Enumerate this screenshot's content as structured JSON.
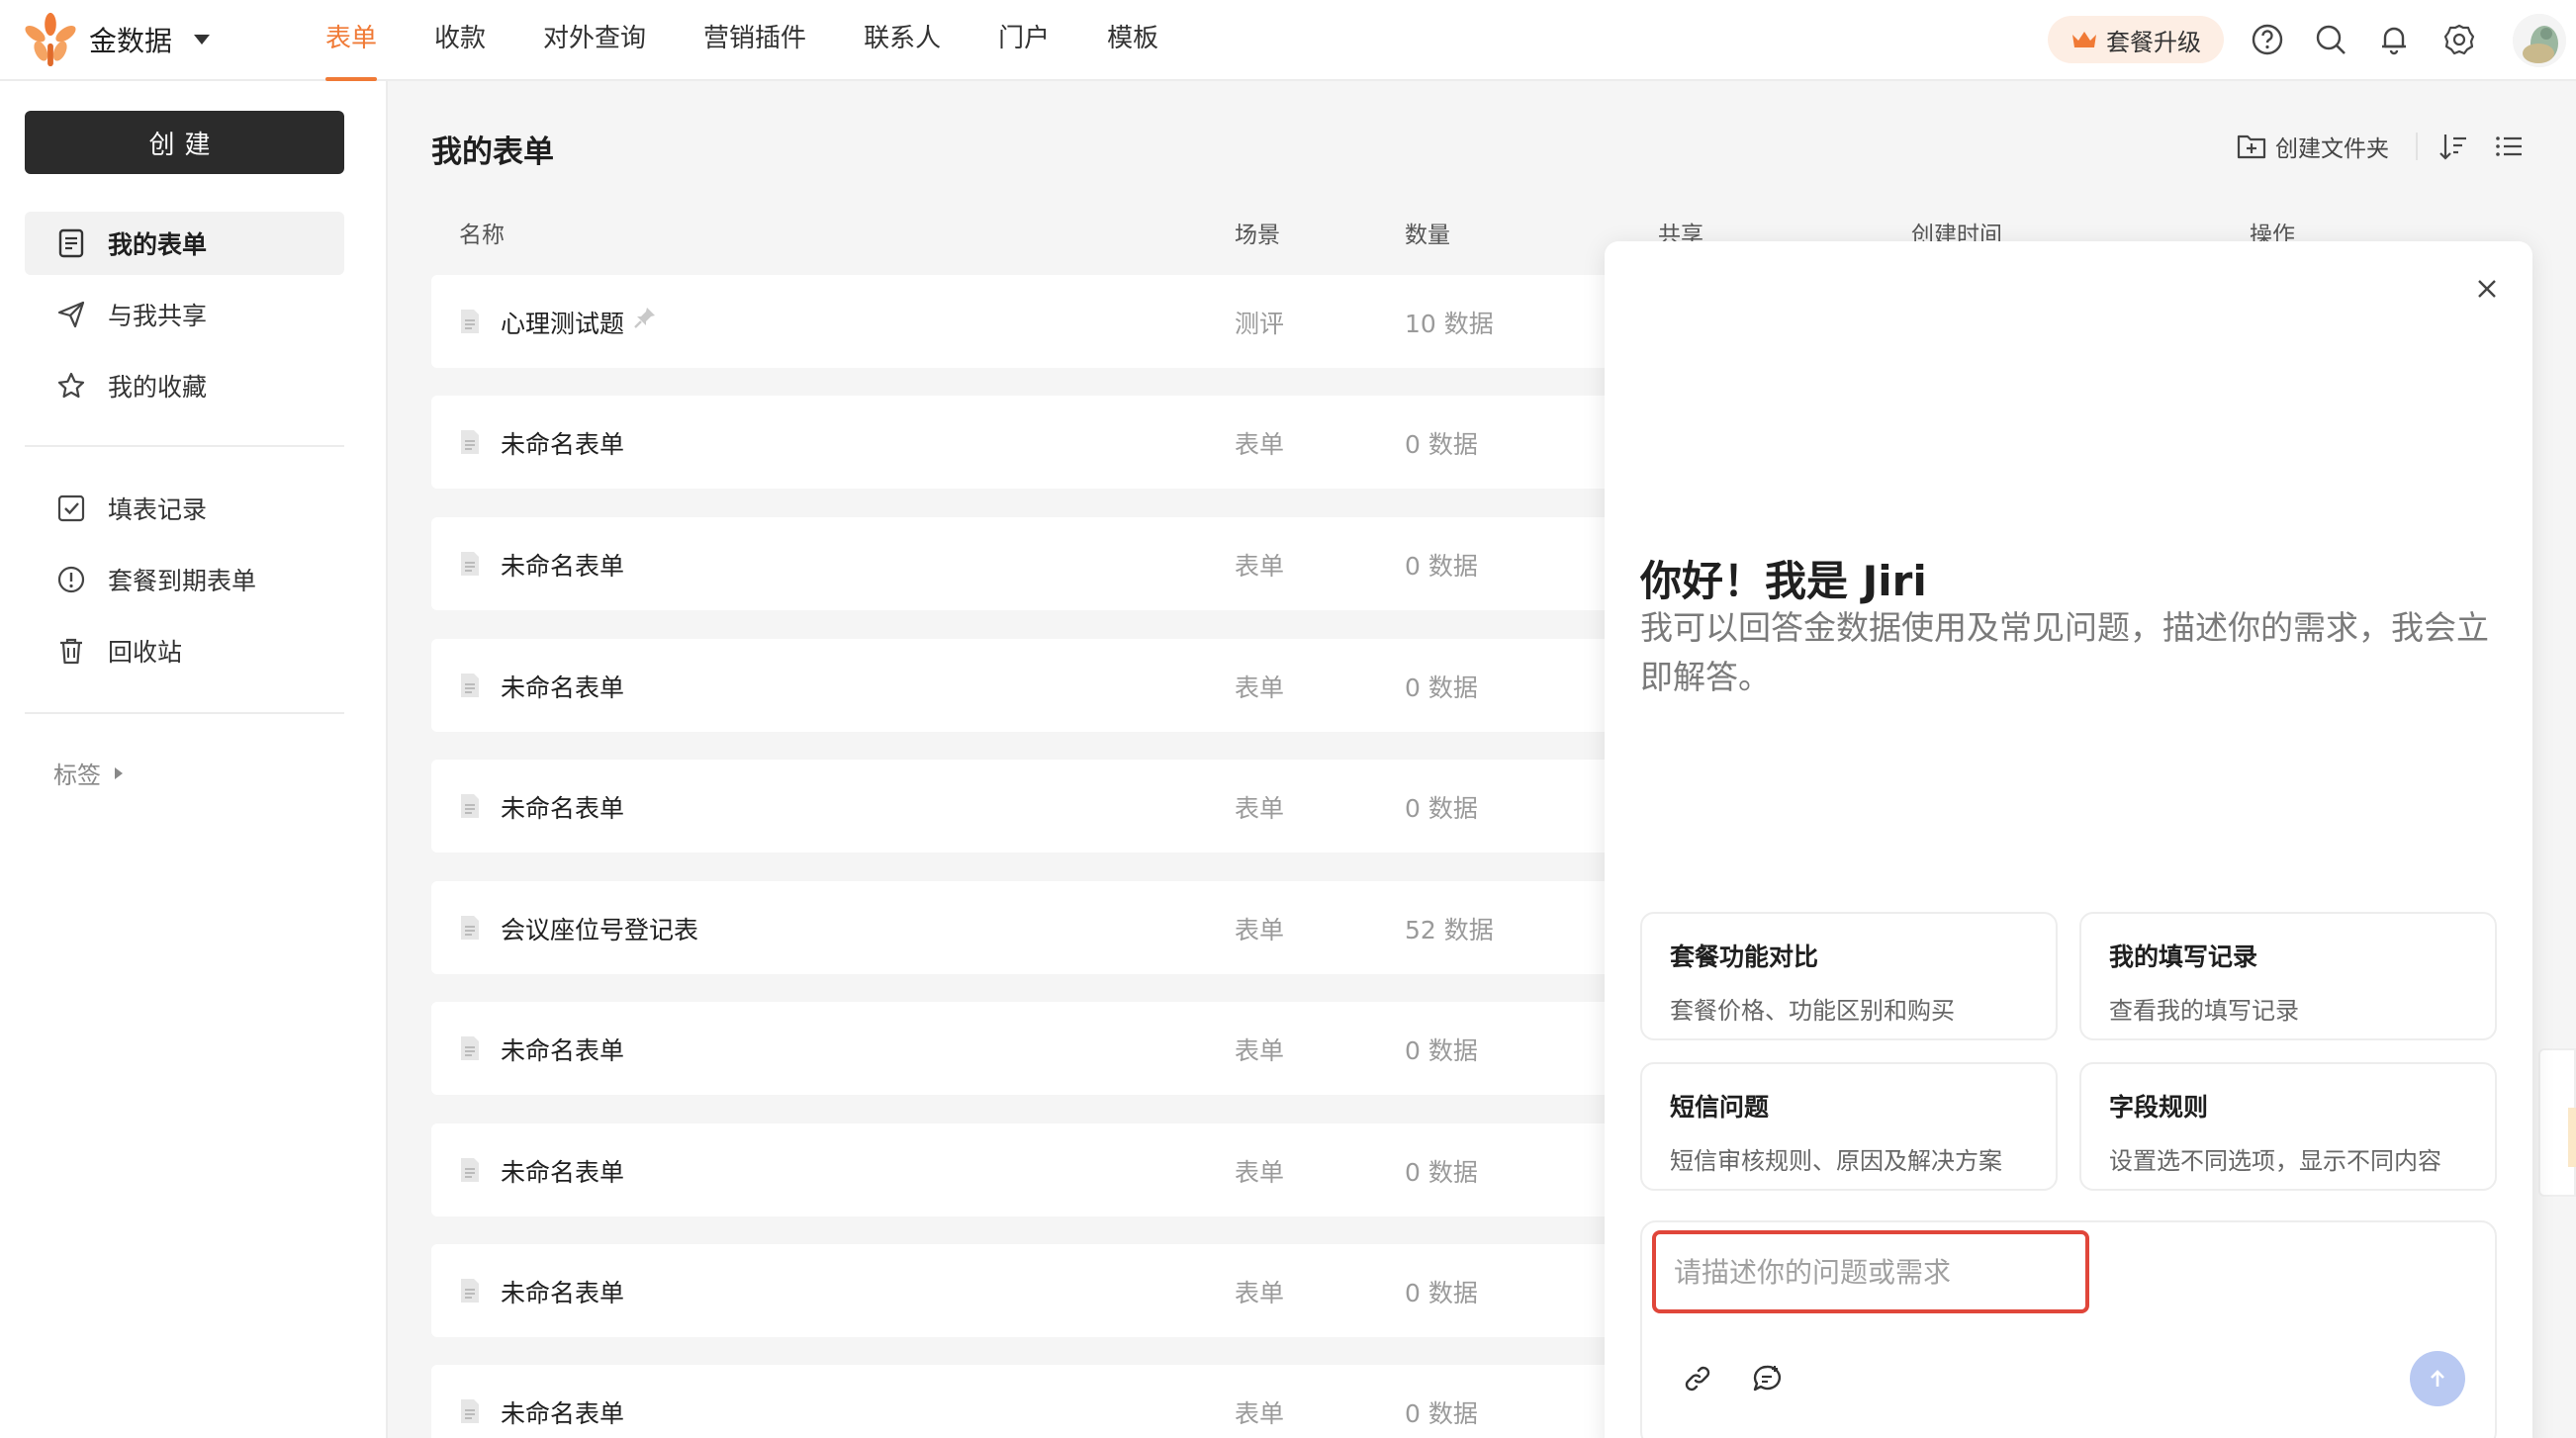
{
  "brand": {
    "name": "金数据"
  },
  "nav": {
    "items": [
      {
        "label": "表单",
        "active": true
      },
      {
        "label": "收款",
        "active": false
      },
      {
        "label": "对外查询",
        "active": false
      },
      {
        "label": "营销插件",
        "active": false
      },
      {
        "label": "联系人",
        "active": false
      },
      {
        "label": "门户",
        "active": false
      },
      {
        "label": "模板",
        "active": false
      }
    ],
    "upgrade_label": "套餐升级"
  },
  "sidebar": {
    "create_label": "创建",
    "items": [
      {
        "label": "我的表单",
        "icon": "doc-icon",
        "active": true
      },
      {
        "label": "与我共享",
        "icon": "send-icon",
        "active": false
      },
      {
        "label": "我的收藏",
        "icon": "star-icon",
        "active": false
      },
      {
        "label": "填表记录",
        "icon": "checkbox-icon",
        "active": false
      },
      {
        "label": "套餐到期表单",
        "icon": "alert-circle-icon",
        "active": false
      },
      {
        "label": "回收站",
        "icon": "trash-icon",
        "active": false
      }
    ],
    "tags_label": "标签"
  },
  "main": {
    "title": "我的表单",
    "new_folder_label": "创建文件夹",
    "columns": {
      "name": "名称",
      "scene": "场景",
      "count": "数量",
      "share": "共享",
      "created": "创建时间",
      "actions": "操作"
    },
    "rows": [
      {
        "name": "心理测试题",
        "scene": "测评",
        "count": "10 数据",
        "pinned": true
      },
      {
        "name": "未命名表单",
        "scene": "表单",
        "count": "0 数据",
        "pinned": false
      },
      {
        "name": "未命名表单",
        "scene": "表单",
        "count": "0 数据",
        "pinned": false
      },
      {
        "name": "未命名表单",
        "scene": "表单",
        "count": "0 数据",
        "pinned": false
      },
      {
        "name": "未命名表单",
        "scene": "表单",
        "count": "0 数据",
        "pinned": false
      },
      {
        "name": "会议座位号登记表",
        "scene": "表单",
        "count": "52 数据",
        "pinned": false
      },
      {
        "name": "未命名表单",
        "scene": "表单",
        "count": "0 数据",
        "pinned": false
      },
      {
        "name": "未命名表单",
        "scene": "表单",
        "count": "0 数据",
        "pinned": false
      },
      {
        "name": "未命名表单",
        "scene": "表单",
        "count": "0 数据",
        "pinned": false
      },
      {
        "name": "未命名表单",
        "scene": "表单",
        "count": "0 数据",
        "pinned": false
      }
    ]
  },
  "assistant": {
    "greeting_title": "你好！我是 Jiri",
    "greeting_subtitle": "我可以回答金数据使用及常见问题，描述你的需求，我会立即解答。",
    "cards": [
      {
        "title": "套餐功能对比",
        "desc": "套餐价格、功能区别和购买"
      },
      {
        "title": "我的填写记录",
        "desc": "查看我的填写记录"
      },
      {
        "title": "短信问题",
        "desc": "短信审核规则、原因及解决方案"
      },
      {
        "title": "字段规则",
        "desc": "设置选不同选项，显示不同内容"
      }
    ],
    "input": {
      "value": "",
      "placeholder": "请描述你的问题或需求"
    }
  },
  "colors": {
    "accent": "#f07a36",
    "primary_button": "#2b2b2b",
    "highlight_border": "#e0463a",
    "send_button": "#b9c9f2"
  }
}
